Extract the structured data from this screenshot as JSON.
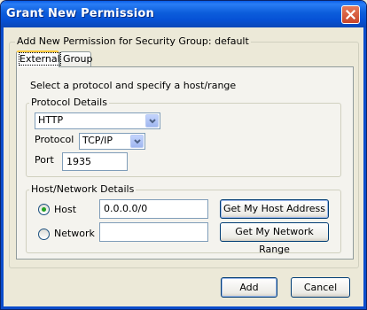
{
  "window": {
    "title": "Grant New Permission"
  },
  "outer_group": {
    "label": "Add New Permission for Security Group: default"
  },
  "tabs": [
    {
      "label": "External",
      "active": true
    },
    {
      "label": "Group",
      "active": false
    }
  ],
  "external": {
    "instructions": "Select a protocol and specify a host/range",
    "protocol_details": {
      "label": "Protocol Details",
      "service_value": "HTTP",
      "protocol_label": "Protocol",
      "protocol_value": "TCP/IP",
      "port_label": "Port",
      "port_value": "1935"
    },
    "host_network": {
      "label": "Host/Network Details",
      "host_label": "Host",
      "host_selected": true,
      "host_value": "0.0.0.0/0",
      "get_host_button": "Get My Host Address",
      "network_label": "Network",
      "network_value": "",
      "get_network_button": "Get My Network Range"
    }
  },
  "buttons": {
    "add": "Add",
    "cancel": "Cancel"
  },
  "colors": {
    "titlebar": "#0652d6",
    "accent_tab": "#ffc83c",
    "radio_dot": "#21a121"
  }
}
